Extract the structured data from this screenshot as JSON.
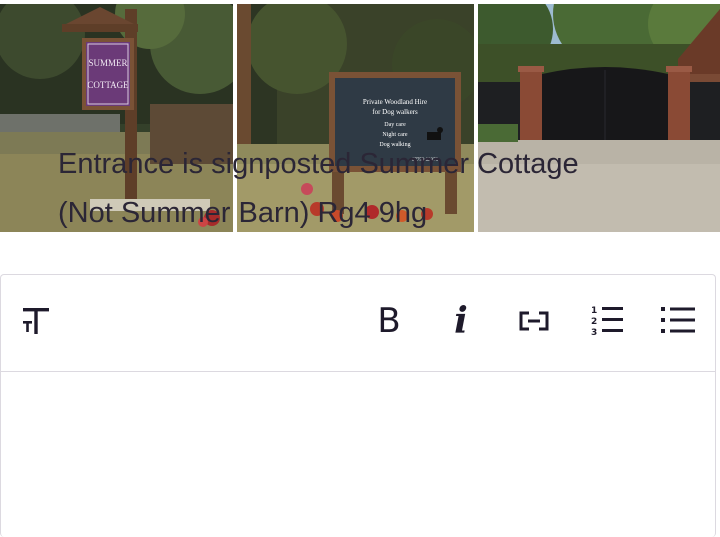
{
  "photos": [
    {
      "name": "sign-summer-cottage",
      "sign_lines": [
        "SUMMER",
        "COTTAGE"
      ]
    },
    {
      "name": "sign-woodland-hire",
      "sign_lines": [
        "Private Woodland Hire",
        "for Dog walkers",
        "Day care",
        "Night care",
        "Dog walking"
      ],
      "phone": "07759 82375"
    },
    {
      "name": "entrance-gate"
    }
  ],
  "toolbar": {
    "bold": "B",
    "italic": "i",
    "icons": [
      "text-size-icon",
      "bold-icon",
      "italic-icon",
      "link-icon",
      "numbered-list-icon",
      "bullet-list-icon"
    ]
  },
  "content": {
    "line1": "Entrance is signposted Summer Cottage",
    "line2": "(Not Summer Barn) Rg4 9hg"
  },
  "colors": {
    "text": "#1e1a2b",
    "border": "#dcd9e0",
    "sign_purple": "#6b3a78",
    "sign_dark": "#2f3a45"
  }
}
